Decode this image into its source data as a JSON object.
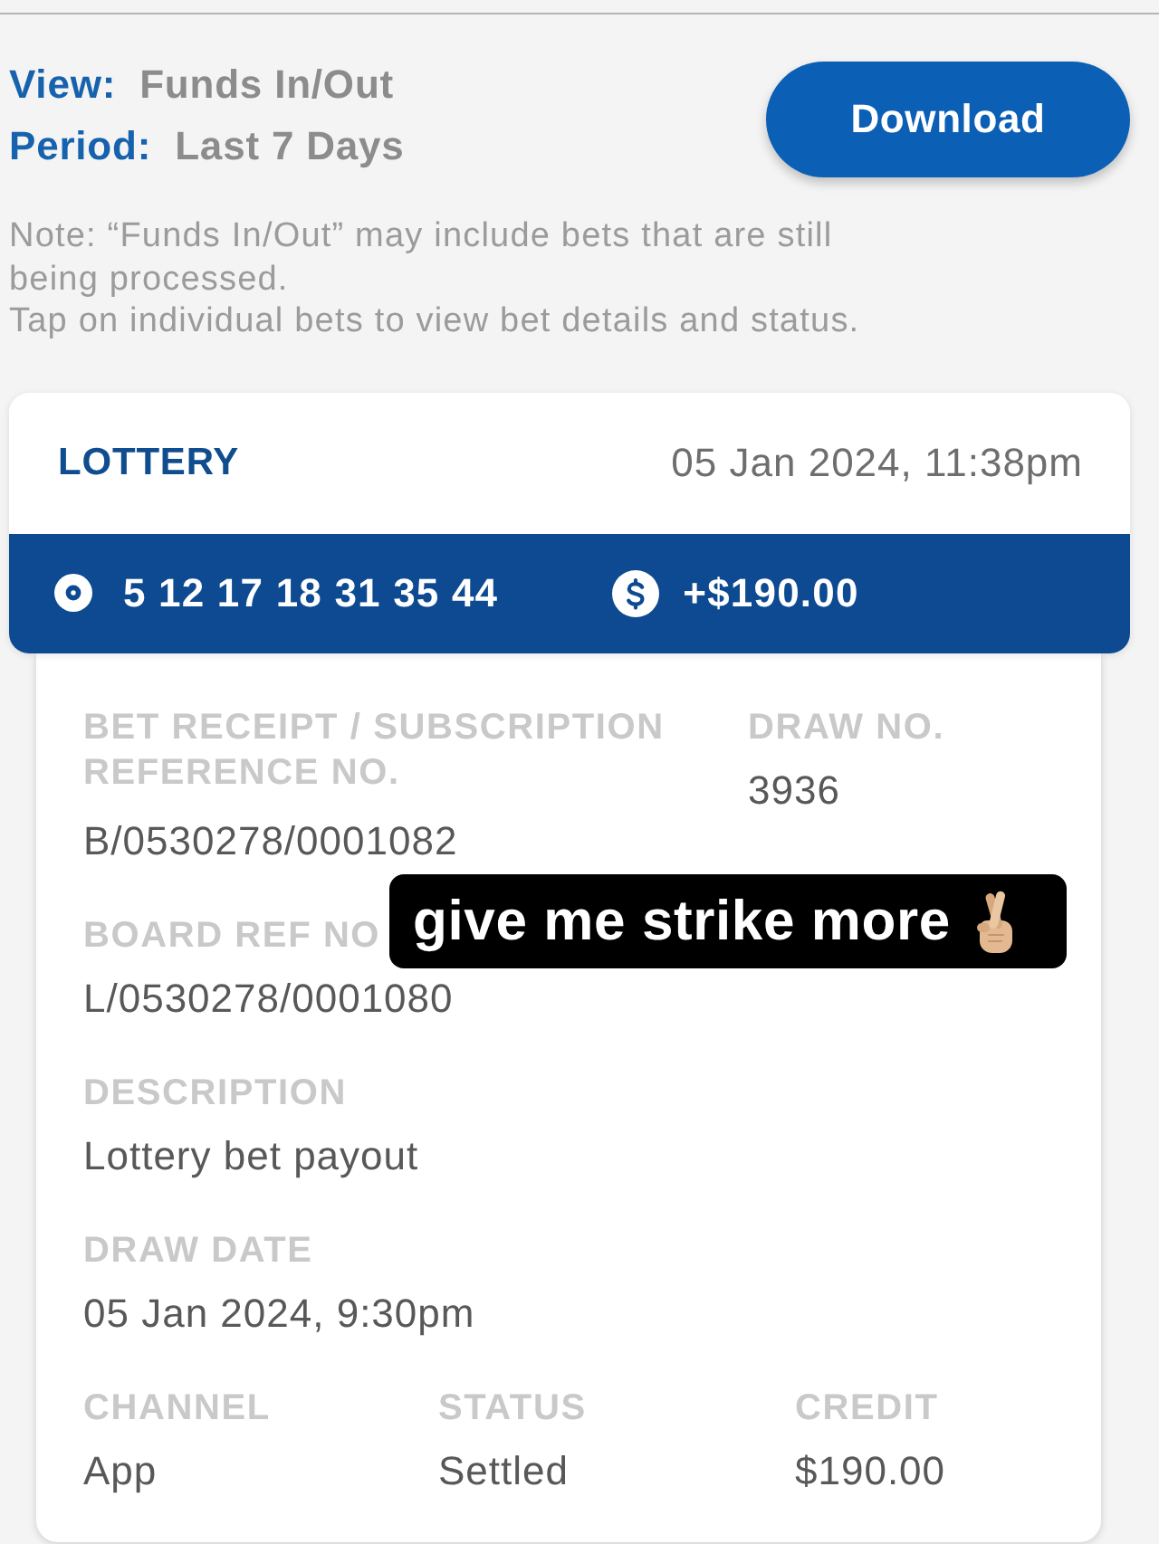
{
  "filter": {
    "view": {
      "label": "View:",
      "value": "Funds In/Out"
    },
    "period": {
      "label": "Period:",
      "value": "Last 7 Days"
    }
  },
  "download_button": {
    "label": "Download"
  },
  "notes": [
    "Note: “Funds In/Out” may include bets that are still being processed.",
    "Tap on individual bets to view bet details and status."
  ],
  "transaction": {
    "type": "LOTTERY",
    "datetime": "05 Jan 2024, 11:38pm",
    "numbers": "5 12 17 18 31 35 44",
    "amount": "+$190.00",
    "details": [
      [
        {
          "label": "BET RECEIPT / SUBSCRIPTION REFERENCE NO.",
          "value": "B/0530278/0001082"
        },
        {
          "label": "DRAW NO.",
          "value": "3936"
        }
      ],
      [
        {
          "label": "BOARD REF NO",
          "value": "L/0530278/0001080"
        }
      ],
      [
        {
          "label": "DESCRIPTION",
          "value": "Lottery bet payout"
        }
      ],
      [
        {
          "label": "DRAW DATE",
          "value": "05 Jan 2024, 9:30pm"
        }
      ],
      [
        {
          "label": "CHANNEL",
          "value": "App"
        },
        {
          "label": "STATUS",
          "value": "Settled"
        },
        {
          "label": "CREDIT",
          "value": "$190.00"
        }
      ]
    ]
  },
  "caption_overlay": {
    "text": "give me strike more"
  }
}
